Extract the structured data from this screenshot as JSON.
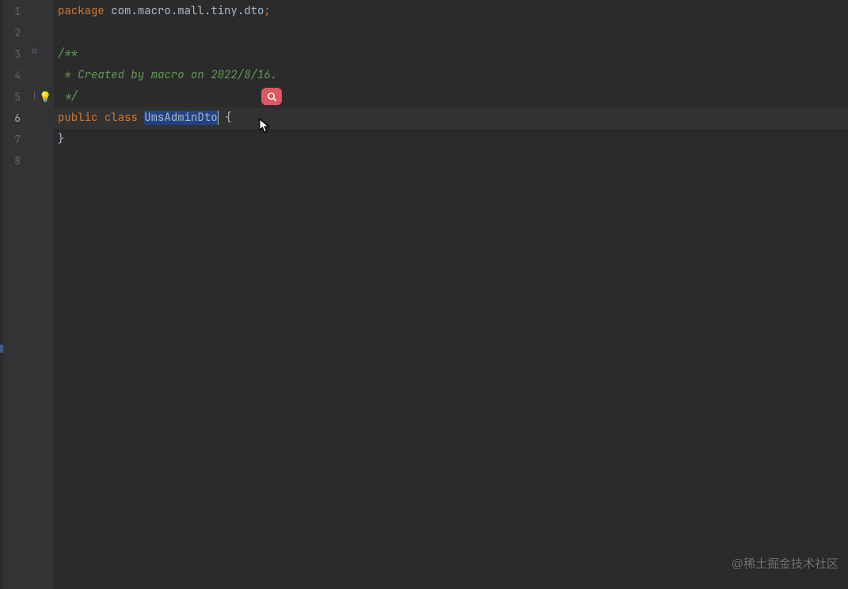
{
  "lines": {
    "count": 8,
    "active": 6,
    "l1_kw": "package",
    "l1_sp": " ",
    "l1_pkg": "com.macro.mall.tiny.dto",
    "l1_semi": ";",
    "l3": "/**",
    "l4": " * Created by macro on 2022/8/16.",
    "l5": " */",
    "l6_kw1": "public",
    "l6_sp1": " ",
    "l6_kw2": "class",
    "l6_sp2": " ",
    "l6_cls": "UmsAdminDto",
    "l6_sp3": " ",
    "l6_brace": "{",
    "l7": "}"
  },
  "icons": {
    "bulb": "💡"
  },
  "watermark": "@稀土掘金技术社区"
}
